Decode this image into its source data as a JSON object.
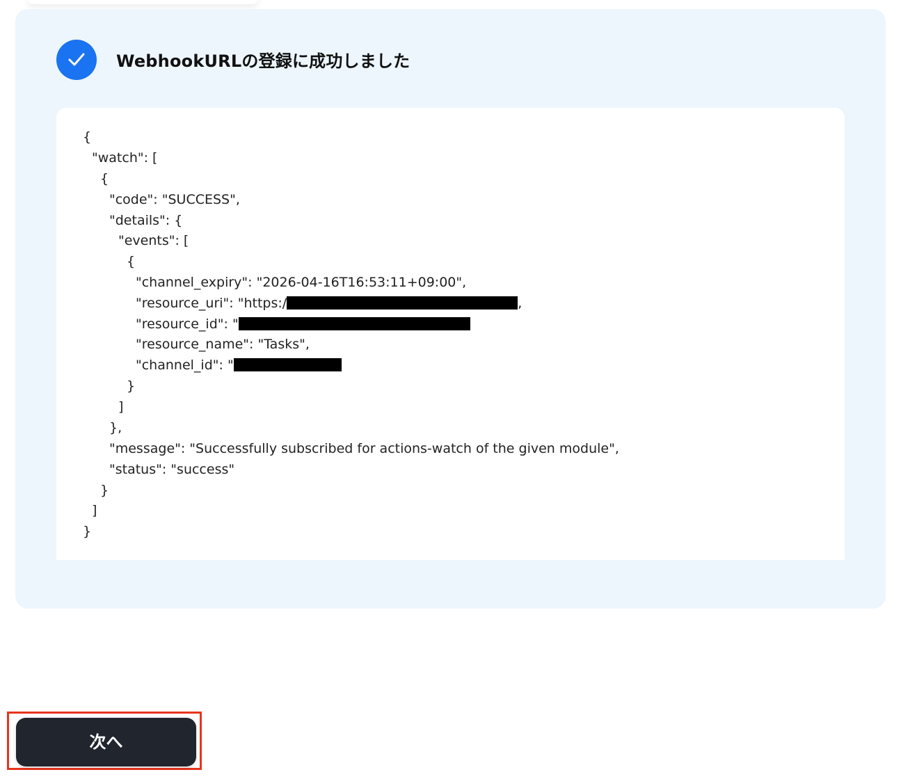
{
  "header": {
    "title": "WebhookURLの登録に成功しました"
  },
  "response": {
    "lines": [
      "{",
      "\"watch\": [",
      "{",
      "\"code\": \"SUCCESS\",",
      "\"details\": {",
      "\"events\": [",
      "{",
      "\"channel_expiry\": \"2026-04-16T16:53:11+09:00\",",
      "\"resource_uri\": \"https:/",
      "\"resource_id\": \"",
      "\"resource_name\": \"Tasks\",",
      "\"channel_id\": \"",
      "}",
      "]",
      "},",
      "\"message\": \"Successfully subscribed for actions-watch of the given module\",",
      "\"status\": \"success\"",
      "}",
      "]",
      "}"
    ],
    "resource_uri_suffix": ","
  },
  "footer": {
    "next_label": "次へ"
  },
  "colors": {
    "panel_bg": "#edf6fd",
    "check_blue": "#1a73f0",
    "button_bg": "#21252d",
    "highlight_red": "#e8341c"
  },
  "icons": {
    "status": "checkmark-icon"
  }
}
